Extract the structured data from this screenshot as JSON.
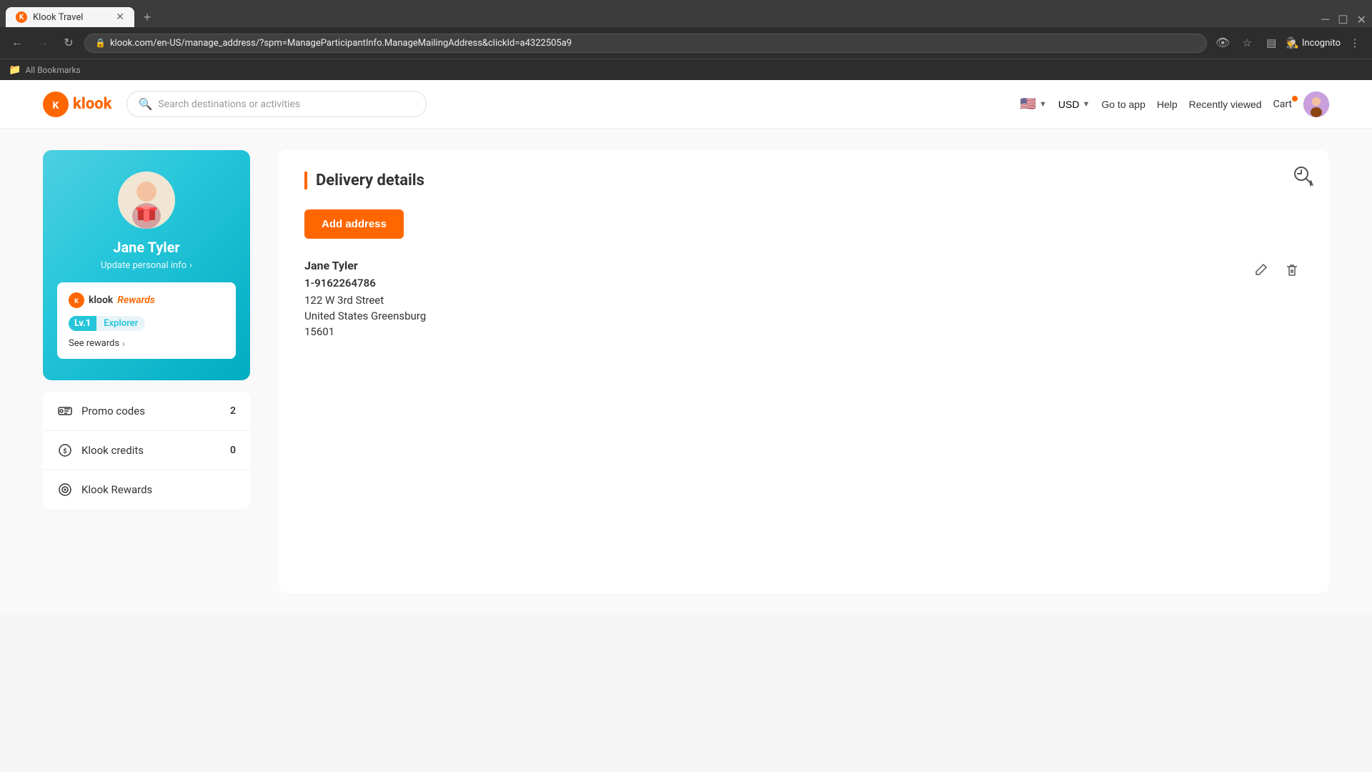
{
  "browser": {
    "tab_title": "Klook Travel",
    "url": "klook.com/en-US/manage_address/?spm=ManageParticipantInfo.ManageMailingAddress&clickId=a4322505a9",
    "new_tab_label": "+",
    "incognito_label": "Incognito",
    "bookmarks_label": "All Bookmarks"
  },
  "nav": {
    "logo_text": "klook",
    "search_placeholder": "Search destinations or activities",
    "currency": "USD",
    "go_to_app": "Go to app",
    "help": "Help",
    "recently_viewed": "Recently viewed",
    "cart": "Cart"
  },
  "sidebar": {
    "profile_name": "Jane Tyler",
    "update_info": "Update personal info",
    "rewards_label": "Rewards",
    "level_lv": "Lv.1",
    "level_name": "Explorer",
    "see_rewards": "See rewards",
    "menu_items": [
      {
        "label": "Promo codes",
        "count": "2",
        "icon": "ticket-icon"
      },
      {
        "label": "Klook credits",
        "count": "0",
        "icon": "coin-icon"
      },
      {
        "label": "Klook Rewards",
        "count": "",
        "icon": "rewards-icon"
      }
    ]
  },
  "delivery": {
    "title": "Delivery details",
    "add_address_btn": "Add address",
    "address": {
      "name": "Jane Tyler",
      "phone": "1-9162264786",
      "street": "122 W 3rd Street",
      "city_state": "United States Greensburg",
      "zip": "15601"
    }
  }
}
